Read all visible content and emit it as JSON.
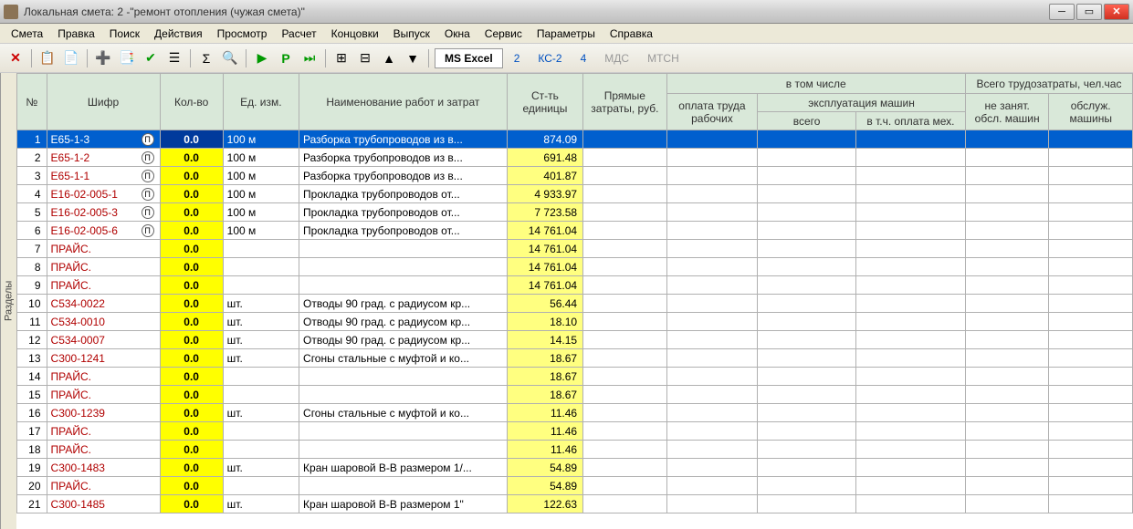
{
  "title": "Локальная смета: 2 -\"ремонт отопления (чужая смета)\"",
  "menu": [
    "Смета",
    "Правка",
    "Поиск",
    "Действия",
    "Просмотр",
    "Расчет",
    "Концовки",
    "Выпуск",
    "Окна",
    "Сервис",
    "Параметры",
    "Справка"
  ],
  "toolbar": {
    "msexcel": "MS Excel",
    "n2": "2",
    "kc2": "КС-2",
    "n4": "4",
    "mds": "МДС",
    "mtsn": "МТСН"
  },
  "side": "Разделы",
  "headers": {
    "num": "№",
    "cipher": "Шифр",
    "qty": "Кол-во",
    "unit": "Ед. изм.",
    "name": "Наименование работ и затрат",
    "cost": "Ст-ть единицы",
    "direct": "Прямые затраты, руб.",
    "including": "в том числе",
    "labor": "оплата труда рабочих",
    "machines": "эксплуатация машин",
    "m_total": "всего",
    "m_pay": "в т.ч. оплата мех.",
    "labortotal": "Всего трудозатраты, чел.час",
    "t_notbusy": "не занят. обсл. машин",
    "t_machines": "обслуж. машины"
  },
  "rows": [
    {
      "n": "1",
      "c": "Е65-1-3",
      "pi": true,
      "q": "0.0",
      "u": "100 м",
      "nm": "Разборка трубопроводов из в...",
      "cost": "874.09",
      "sel": true
    },
    {
      "n": "2",
      "c": "Е65-1-2",
      "pi": true,
      "q": "0.0",
      "u": "100 м",
      "nm": "Разборка трубопроводов из в...",
      "cost": "691.48"
    },
    {
      "n": "3",
      "c": "Е65-1-1",
      "pi": true,
      "q": "0.0",
      "u": "100 м",
      "nm": "Разборка трубопроводов из в...",
      "cost": "401.87"
    },
    {
      "n": "4",
      "c": "Е16-02-005-1",
      "pi": true,
      "q": "0.0",
      "u": "100 м",
      "nm": "Прокладка трубопроводов от...",
      "cost": "4 933.97"
    },
    {
      "n": "5",
      "c": "Е16-02-005-3",
      "pi": true,
      "q": "0.0",
      "u": "100 м",
      "nm": "Прокладка трубопроводов от...",
      "cost": "7 723.58"
    },
    {
      "n": "6",
      "c": "Е16-02-005-6",
      "pi": true,
      "q": "0.0",
      "u": "100 м",
      "nm": "Прокладка трубопроводов от...",
      "cost": "14 761.04"
    },
    {
      "n": "7",
      "c": "ПРАЙС.",
      "q": "0.0",
      "u": "",
      "nm": "",
      "cost": "14 761.04"
    },
    {
      "n": "8",
      "c": "ПРАЙС.",
      "q": "0.0",
      "u": "",
      "nm": "",
      "cost": "14 761.04"
    },
    {
      "n": "9",
      "c": "ПРАЙС.",
      "q": "0.0",
      "u": "",
      "nm": "",
      "cost": "14 761.04"
    },
    {
      "n": "10",
      "c": "С534-0022",
      "q": "0.0",
      "u": "шт.",
      "nm": "Отводы 90 град. с радиусом кр...",
      "cost": "56.44"
    },
    {
      "n": "11",
      "c": "С534-0010",
      "q": "0.0",
      "u": "шт.",
      "nm": "Отводы 90 град. с радиусом кр...",
      "cost": "18.10"
    },
    {
      "n": "12",
      "c": "С534-0007",
      "q": "0.0",
      "u": "шт.",
      "nm": "Отводы 90 град. с радиусом кр...",
      "cost": "14.15"
    },
    {
      "n": "13",
      "c": "С300-1241",
      "q": "0.0",
      "u": "шт.",
      "nm": "Сгоны стальные с муфтой и ко...",
      "cost": "18.67"
    },
    {
      "n": "14",
      "c": "ПРАЙС.",
      "q": "0.0",
      "u": "",
      "nm": "",
      "cost": "18.67"
    },
    {
      "n": "15",
      "c": "ПРАЙС.",
      "q": "0.0",
      "u": "",
      "nm": "",
      "cost": "18.67"
    },
    {
      "n": "16",
      "c": "С300-1239",
      "q": "0.0",
      "u": "шт.",
      "nm": "Сгоны стальные с муфтой и ко...",
      "cost": "11.46"
    },
    {
      "n": "17",
      "c": "ПРАЙС.",
      "q": "0.0",
      "u": "",
      "nm": "",
      "cost": "11.46"
    },
    {
      "n": "18",
      "c": "ПРАЙС.",
      "q": "0.0",
      "u": "",
      "nm": "",
      "cost": "11.46"
    },
    {
      "n": "19",
      "c": "С300-1483",
      "q": "0.0",
      "u": "шт.",
      "nm": "Кран шаровой В-В размером 1/...",
      "cost": "54.89"
    },
    {
      "n": "20",
      "c": "ПРАЙС.",
      "q": "0.0",
      "u": "",
      "nm": "",
      "cost": "54.89"
    },
    {
      "n": "21",
      "c": "С300-1485",
      "q": "0.0",
      "u": "шт.",
      "nm": "Кран шаровой В-В размером 1\"",
      "cost": "122.63"
    }
  ]
}
